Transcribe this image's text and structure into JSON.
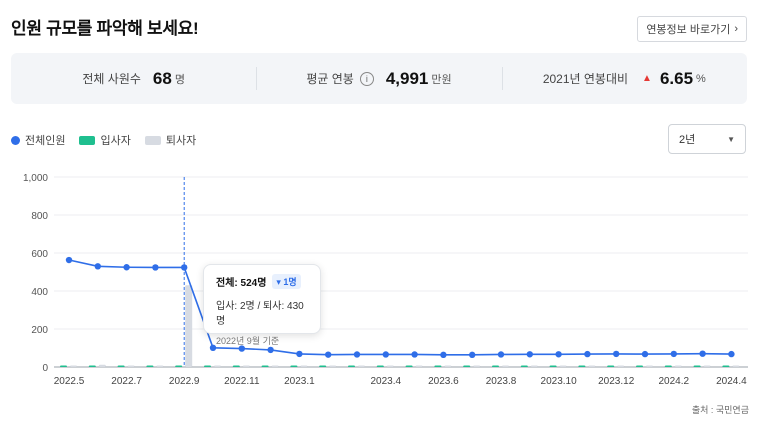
{
  "header": {
    "title": "인원 규모를 파악해 보세요!",
    "salary_link": "연봉정보 바로가기",
    "salary_link_icon": "chevron-right-icon"
  },
  "summary": [
    {
      "label": "전체 사원수",
      "value": "68",
      "unit": "명"
    },
    {
      "label": "평균 연봉",
      "value": "4,991",
      "unit": "만원",
      "icon": "info-icon"
    },
    {
      "label": "2021년 연봉대비",
      "value": "6.65",
      "unit": "%",
      "icon": "triangle-up-icon",
      "icon_color": "#e53935"
    }
  ],
  "legend": [
    {
      "name": "전체인원",
      "color": "#2f6ee8",
      "shape": "dot"
    },
    {
      "name": "입사자",
      "color": "#1fbf8f",
      "shape": "rect"
    },
    {
      "name": "퇴사자",
      "color": "#d7dbe2",
      "shape": "rect"
    }
  ],
  "period_select": {
    "value": "2년"
  },
  "tooltip": {
    "total": "전체: 524명",
    "change": "▾ 1명",
    "detail": "입사: 2명 / 퇴사: 430명",
    "date": "2022년 9월 기준"
  },
  "source": "출처 : 국민연금",
  "chart_data": {
    "type": "line",
    "x_ticks": [
      "2022.5",
      "2022.7",
      "2022.9",
      "2022.11",
      "2023.1",
      "2023.4",
      "2023.6",
      "2023.8",
      "2023.10",
      "2023.12",
      "2024.2",
      "2024.4"
    ],
    "y_ticks": [
      "0",
      "200",
      "400",
      "600",
      "800",
      "1,000"
    ],
    "ylim": [
      0,
      1000
    ],
    "series": [
      {
        "name": "전체인원",
        "color": "#2f6ee8",
        "values": [
          563,
          530,
          525,
          524,
          524,
          101,
          97,
          90,
          69,
          65,
          66,
          66,
          66,
          64,
          64,
          66,
          67,
          67,
          68,
          69,
          68,
          69,
          70,
          68
        ]
      },
      {
        "name": "입사자",
        "color": "#1fbf8f",
        "values": [
          3,
          3,
          5,
          5,
          4,
          0,
          2,
          2,
          2,
          1,
          1,
          1,
          1,
          1,
          1,
          1,
          1,
          1,
          1,
          1,
          1,
          1,
          1,
          1
        ]
      },
      {
        "name": "퇴사자",
        "color": "#d7dbe2",
        "values": [
          2,
          12,
          6,
          3,
          430,
          3,
          3,
          2,
          3,
          1,
          1,
          1,
          1,
          1,
          1,
          1,
          1,
          1,
          1,
          1,
          1,
          1,
          1,
          1
        ]
      }
    ],
    "highlight_index": 4
  }
}
